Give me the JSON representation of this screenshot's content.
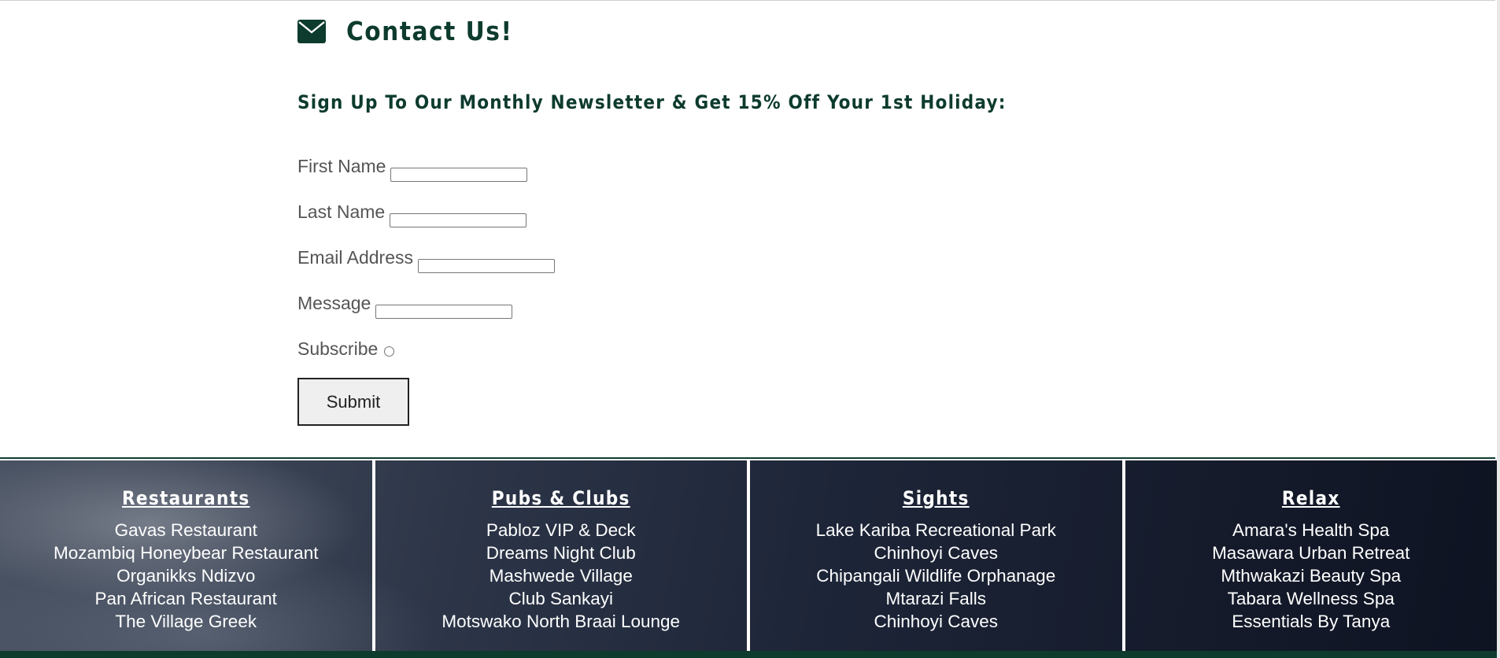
{
  "contact": {
    "title": "Contact Us!",
    "icon": "envelope-icon",
    "newsletter_heading": "Sign Up To Our Monthly Newsletter & Get 15% Off Your 1st Holiday:",
    "fields": {
      "first_name": {
        "label": "First Name",
        "value": ""
      },
      "last_name": {
        "label": "Last Name",
        "value": ""
      },
      "email": {
        "label": "Email Address",
        "value": ""
      },
      "message": {
        "label": "Message",
        "value": ""
      }
    },
    "subscribe_label": "Subscribe",
    "submit_label": "Submit"
  },
  "footer": {
    "columns": [
      {
        "title": "Restaurants",
        "items": [
          "Gavas Restaurant",
          "Mozambiq Honeybear Restaurant",
          "Organikks Ndizvo",
          "Pan African Restaurant",
          "The Village Greek"
        ]
      },
      {
        "title": "Pubs & Clubs",
        "items": [
          "Pabloz VIP & Deck",
          "Dreams Night Club",
          "Mashwede Village",
          "Club Sankayi",
          "Motswako North Braai Lounge"
        ]
      },
      {
        "title": "Sights",
        "items": [
          "Lake Kariba Recreational Park",
          "Chinhoyi Caves",
          "Chipangali Wildlife Orphanage",
          "Mtarazi Falls",
          "Chinhoyi Caves"
        ]
      },
      {
        "title": "Relax",
        "items": [
          "Amara's Health Spa",
          "Masawara Urban Retreat",
          "Mthwakazi Beauty Spa",
          "Tabara Wellness Spa",
          "Essentials By Tanya"
        ]
      }
    ]
  },
  "colors": {
    "heading_green": "#0d3b2e",
    "footer_text": "#ffffff",
    "body_text": "#555555"
  }
}
